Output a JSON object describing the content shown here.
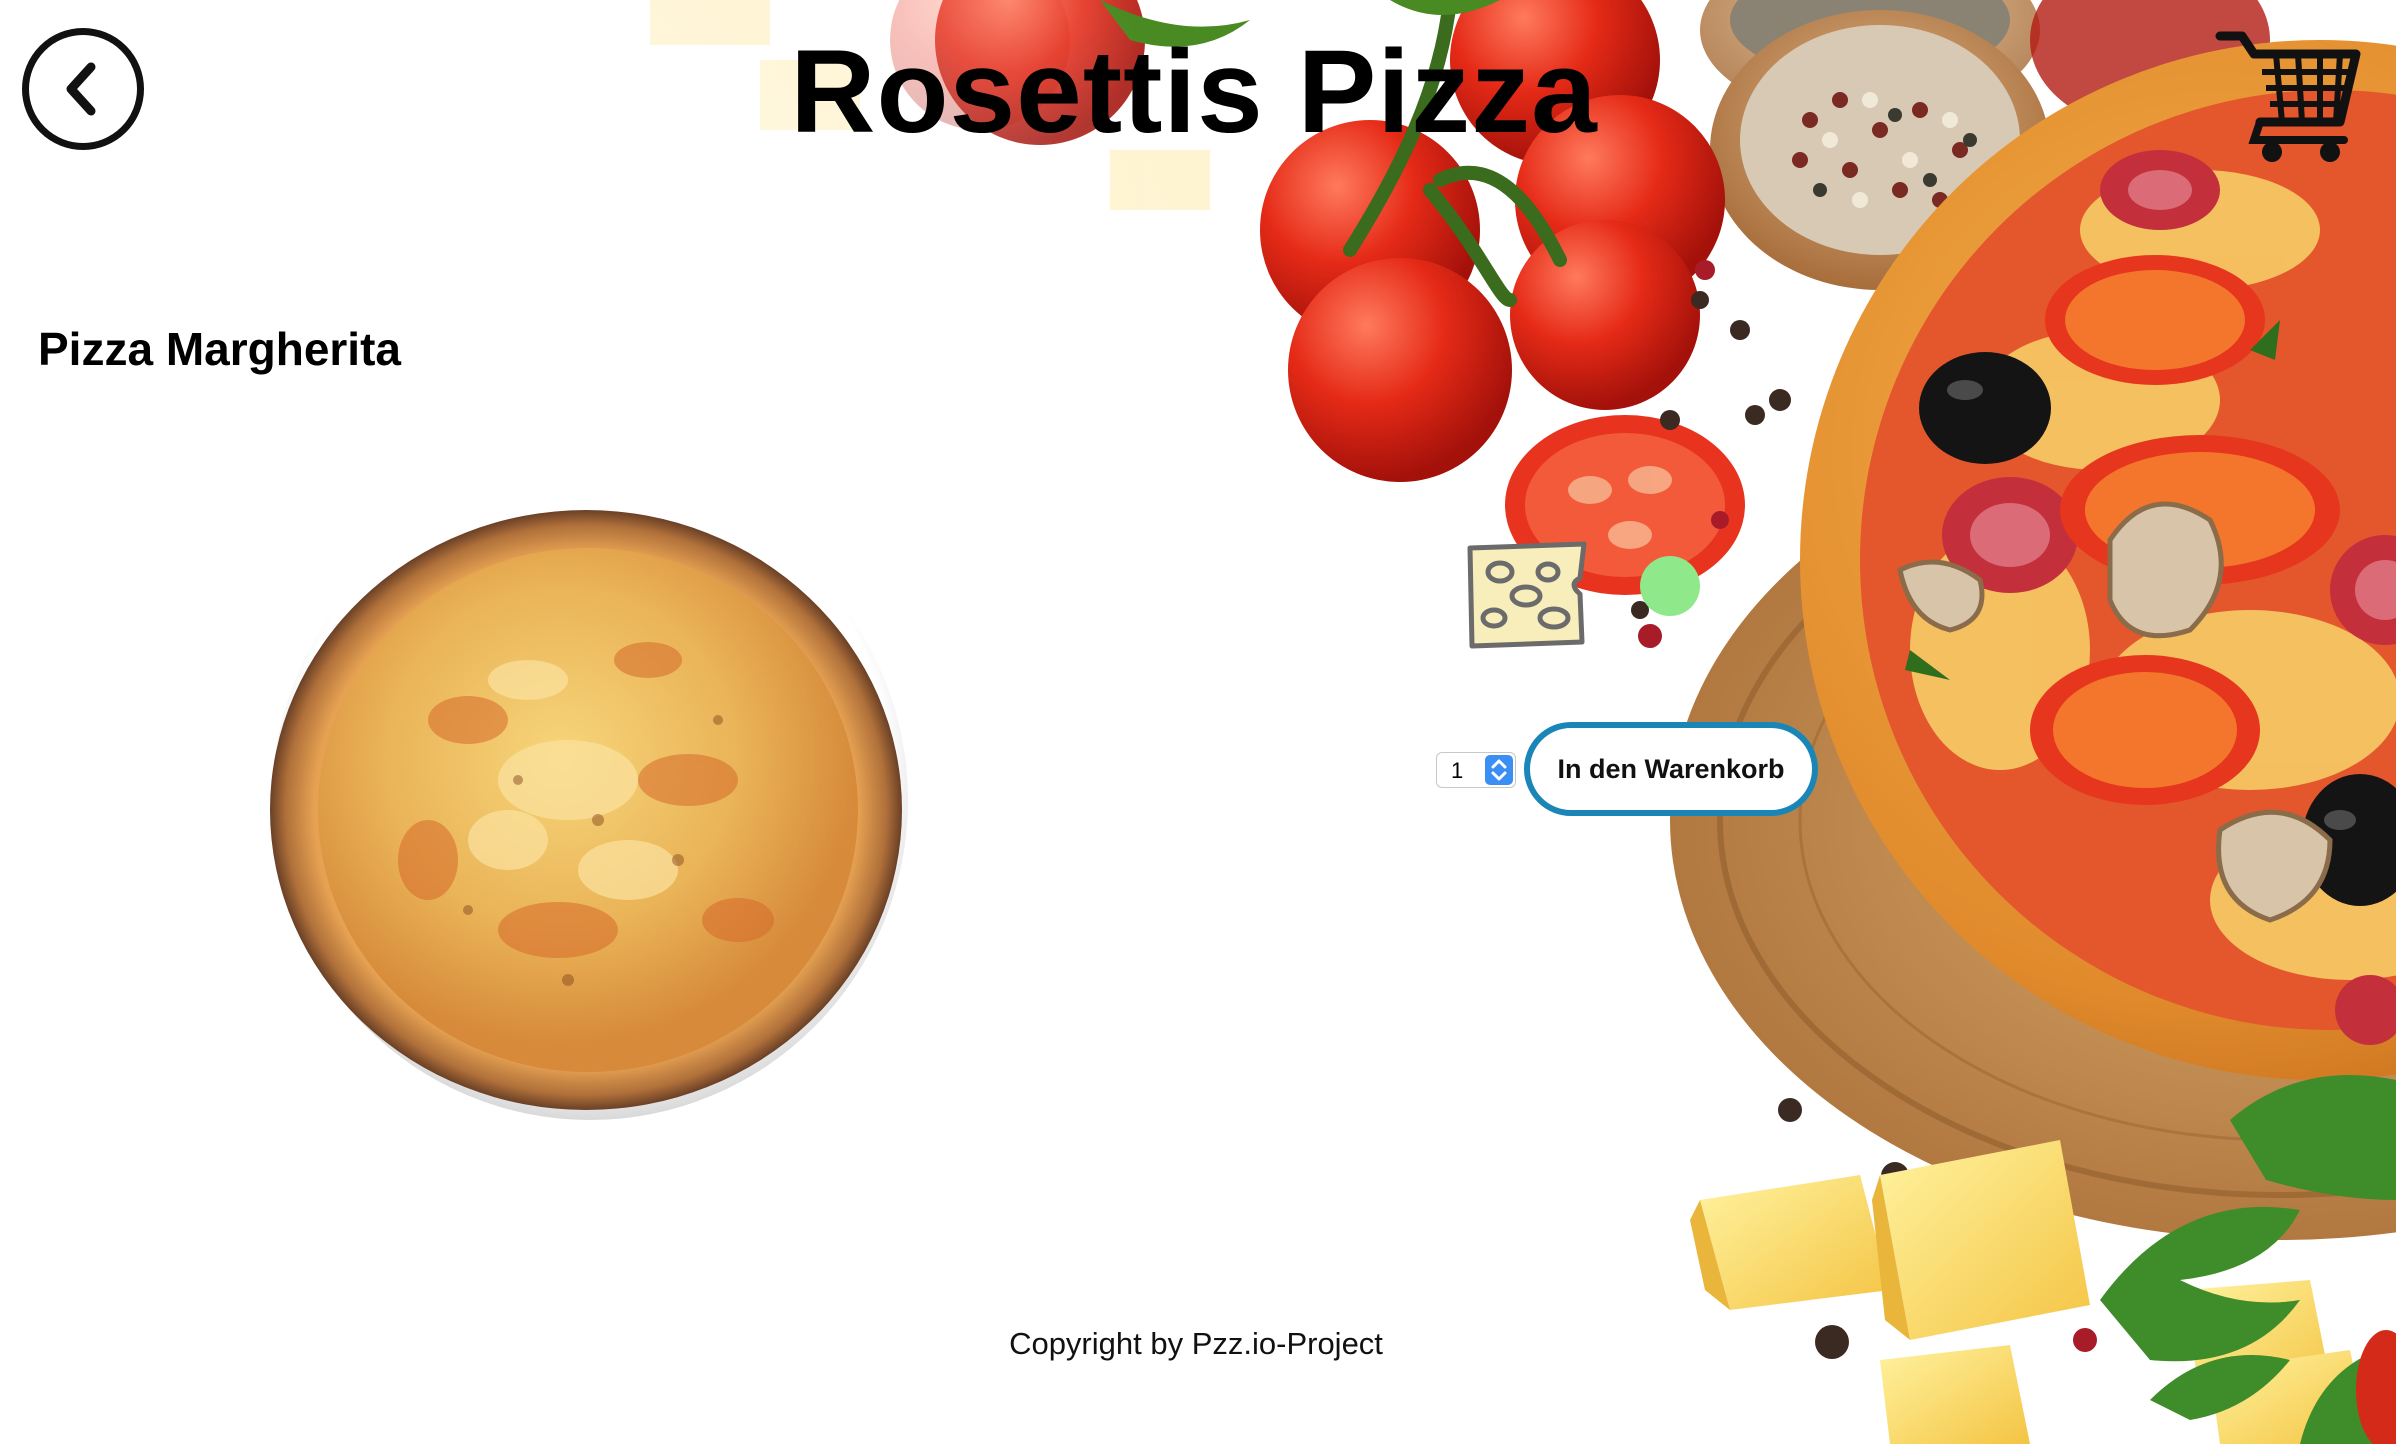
{
  "header": {
    "title": "Rosettis Pizza",
    "back_icon": "chevron-left-icon",
    "cart_icon": "shopping-cart-icon"
  },
  "product": {
    "name": "Pizza Margherita",
    "image": "pizza-margherita-photo",
    "topping_icon": "cheese-icon",
    "status_color": "#8fe88a"
  },
  "order": {
    "quantity": "1",
    "add_to_cart_label": "In den Warenkorb",
    "button_border_color": "#1a86b8"
  },
  "footer": {
    "copyright": "Copyright by Pzz.io-Project"
  }
}
